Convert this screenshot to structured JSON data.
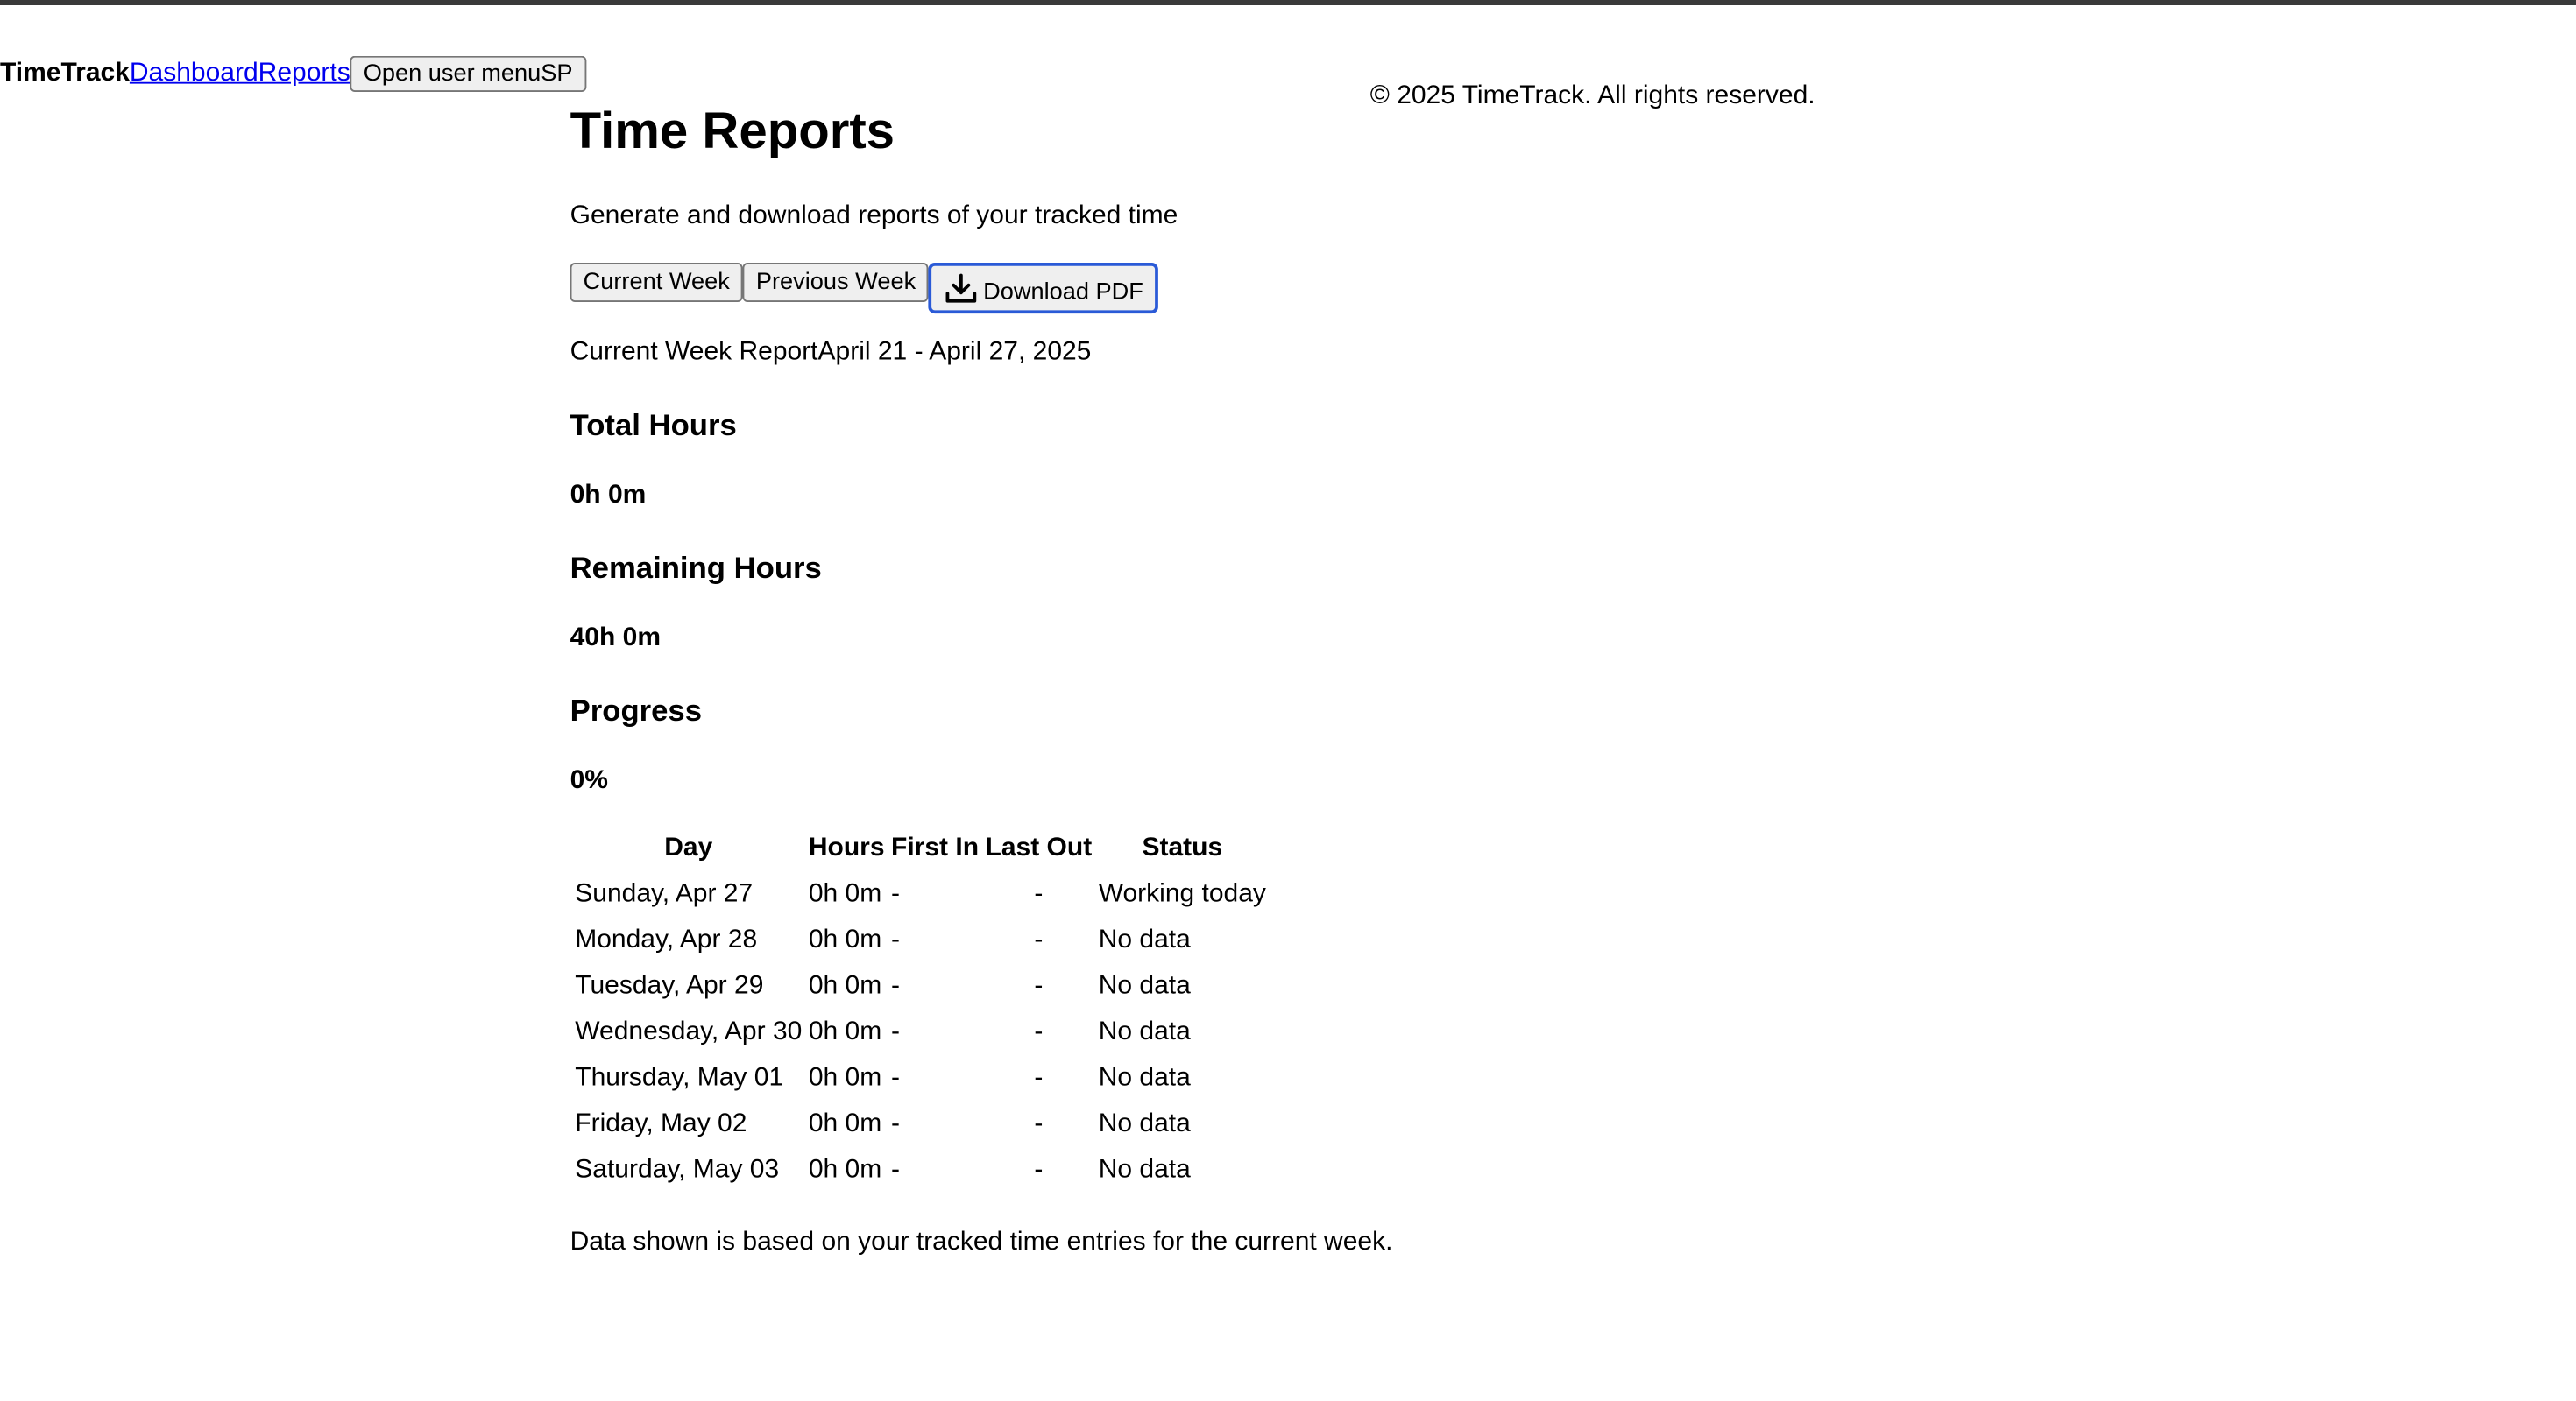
{
  "header": {
    "brand": "TimeTrack",
    "nav": [
      "Dashboard",
      "Reports"
    ],
    "user_menu_label": "Open user menu",
    "user_initials": "SP"
  },
  "footer": {
    "copyright": "© 2025 TimeTrack. All rights reserved."
  },
  "main": {
    "title": "Time Reports",
    "subtitle": "Generate and download reports of your tracked time",
    "buttons": {
      "current_week": "Current Week",
      "previous_week": "Previous Week",
      "download_pdf": "Download PDF"
    },
    "report_label": "Current Week Report",
    "date_range": "April 21 - April 27, 2025",
    "stats": {
      "total_label": "Total Hours",
      "total_value": "0h 0m",
      "remaining_label": "Remaining Hours",
      "remaining_value": "40h 0m",
      "progress_label": "Progress",
      "progress_value": "0%"
    },
    "table": {
      "headers": [
        "Day",
        "Hours",
        "First In",
        "Last Out",
        "Status"
      ],
      "rows": [
        [
          "Sunday, Apr 27",
          "0h 0m",
          "-",
          "-",
          "Working today"
        ],
        [
          "Monday, Apr 28",
          "0h 0m",
          "-",
          "-",
          "No data"
        ],
        [
          "Tuesday, Apr 29",
          "0h 0m",
          "-",
          "-",
          "No data"
        ],
        [
          "Wednesday, Apr 30",
          "0h 0m",
          "-",
          "-",
          "No data"
        ],
        [
          "Thursday, May 01",
          "0h 0m",
          "-",
          "-",
          "No data"
        ],
        [
          "Friday, May 02",
          "0h 0m",
          "-",
          "-",
          "No data"
        ],
        [
          "Saturday, May 03",
          "0h 0m",
          "-",
          "-",
          "No data"
        ]
      ]
    },
    "note": "Data shown is based on your tracked time entries for the current week."
  },
  "icons": {
    "download_pdf": "download-icon"
  },
  "colors": {
    "link": "#0000ee",
    "focus_border": "#2a5ad7",
    "top_bar": "#3a3a3a"
  }
}
